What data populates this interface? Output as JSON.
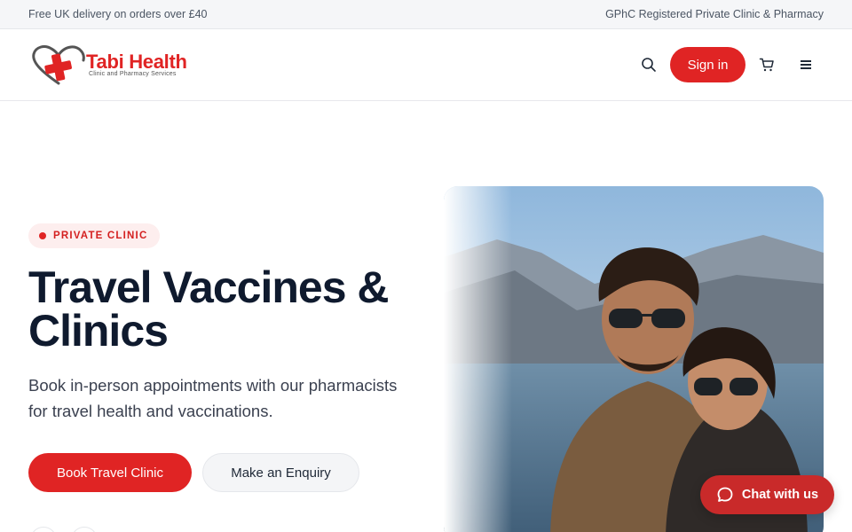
{
  "topbar": {
    "left_text": "Free UK delivery on orders over £40",
    "right_text": "GPhC Registered Private Clinic & Pharmacy"
  },
  "header": {
    "logo_name": "Tabi Health",
    "logo_tagline": "Clinic and Pharmacy Services",
    "search_icon": "search-icon",
    "signin_label": "Sign in",
    "cart_icon": "cart-icon",
    "menu_icon": "menu-icon"
  },
  "hero": {
    "badge": "PRIVATE CLINIC",
    "title": "Travel Vaccines & Clinics",
    "subtitle": "Book in-person appointments with our pharmacists for travel health and vaccinations.",
    "primary_cta": "Book Travel Clinic",
    "secondary_cta": "Make an Enquiry"
  },
  "chat": {
    "label": "Chat with us",
    "icon": "chat-bubble-icon"
  },
  "colors": {
    "brand_red": "#e02424",
    "heading": "#0f1a2e",
    "chat_red": "#c92a2a"
  }
}
